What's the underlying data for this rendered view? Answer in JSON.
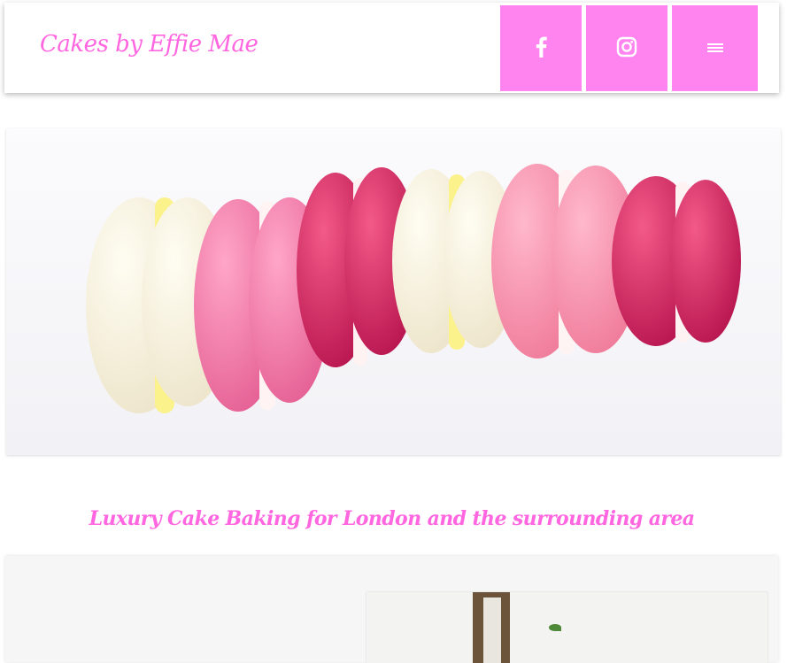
{
  "header": {
    "logo_text": "Cakes by Effie Mae",
    "buttons": [
      {
        "name": "facebook",
        "icon": "facebook-icon"
      },
      {
        "name": "instagram",
        "icon": "instagram-icon"
      },
      {
        "name": "menu",
        "icon": "hamburger-menu-icon"
      }
    ]
  },
  "hero": {
    "image": "pink-and-cream-macarons-row"
  },
  "tagline": "Luxury Cake Baking for London and the surrounding area",
  "colors": {
    "accent": "#ff66e0",
    "button_bg": "#ff84f0"
  }
}
